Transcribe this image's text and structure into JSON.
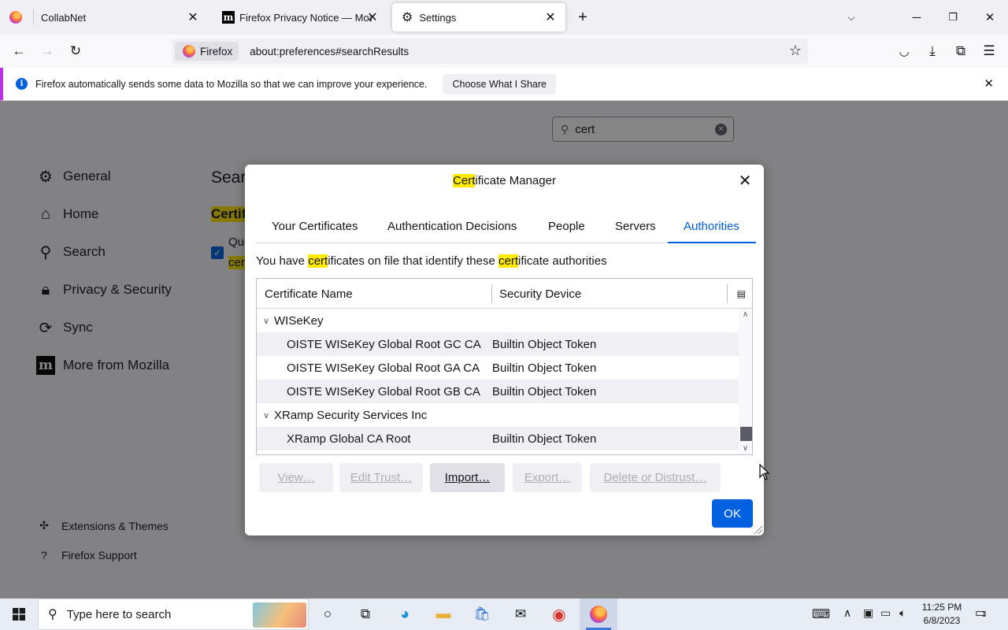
{
  "browser": {
    "tabs": [
      {
        "title": "CollabNet",
        "icon": "firefox-icon"
      },
      {
        "title": "Firefox Privacy Notice — Mozill",
        "icon": "mozilla-m-icon"
      },
      {
        "title": "Settings",
        "icon": "gear-icon",
        "active": true
      }
    ],
    "identity_label": "Firefox",
    "url": "about:preferences#searchResults"
  },
  "notification": {
    "text": "Firefox automatically sends some data to Mozilla so that we can improve your experience.",
    "button": "Choose What I Share"
  },
  "prefs": {
    "search_value": "cert",
    "categories": [
      {
        "label": "General",
        "icon": "gear-icon"
      },
      {
        "label": "Home",
        "icon": "home-icon"
      },
      {
        "label": "Search",
        "icon": "search-icon"
      },
      {
        "label": "Privacy & Security",
        "icon": "lock-icon"
      },
      {
        "label": "Sync",
        "icon": "sync-icon"
      },
      {
        "label": "More from Mozilla",
        "icon": "mozilla-m-icon"
      }
    ],
    "footer_links": [
      {
        "label": "Extensions & Themes",
        "icon": "puzzle-icon"
      },
      {
        "label": "Firefox Support",
        "icon": "help-icon"
      }
    ],
    "heading_partial": "Sear",
    "section_partial": "Certif",
    "check_line1_partial": "Que",
    "check_line2_partial": "cer"
  },
  "dialog": {
    "title_highlight": "Cert",
    "title_rest": "ificate Manager",
    "tabs": [
      "Your Certificates",
      "Authentication Decisions",
      "People",
      "Servers",
      "Authorities"
    ],
    "active_tab": "Authorities",
    "desc": {
      "p1": "You have ",
      "h1": "cert",
      "p2": "ificates on file that identify these ",
      "h2": "cert",
      "p3": "ificate authorities"
    },
    "columns": [
      "Certificate Name",
      "Security Device"
    ],
    "rows": [
      {
        "name": "WISeKey",
        "device": "",
        "group": true
      },
      {
        "name": "OISTE WISeKey Global Root GC CA",
        "device": "Builtin Object Token"
      },
      {
        "name": "OISTE WISeKey Global Root GA CA",
        "device": "Builtin Object Token"
      },
      {
        "name": "OISTE WISeKey Global Root GB CA",
        "device": "Builtin Object Token"
      },
      {
        "name": "XRamp Security Services Inc",
        "device": "",
        "group": true
      },
      {
        "name": "XRamp Global CA Root",
        "device": "Builtin Object Token"
      }
    ],
    "buttons": {
      "view": "View…",
      "edit_trust": "Edit Trust…",
      "import": "Import…",
      "export": "Export…",
      "delete": "Delete or Distrust…",
      "ok": "OK"
    }
  },
  "taskbar": {
    "search_placeholder": "Type here to search",
    "time": "11:25 PM",
    "date": "6/8/2023",
    "notification_count": "1"
  },
  "colors": {
    "accent": "#0060df",
    "highlight": "#ffe900",
    "notification_border": "#b833e1"
  }
}
